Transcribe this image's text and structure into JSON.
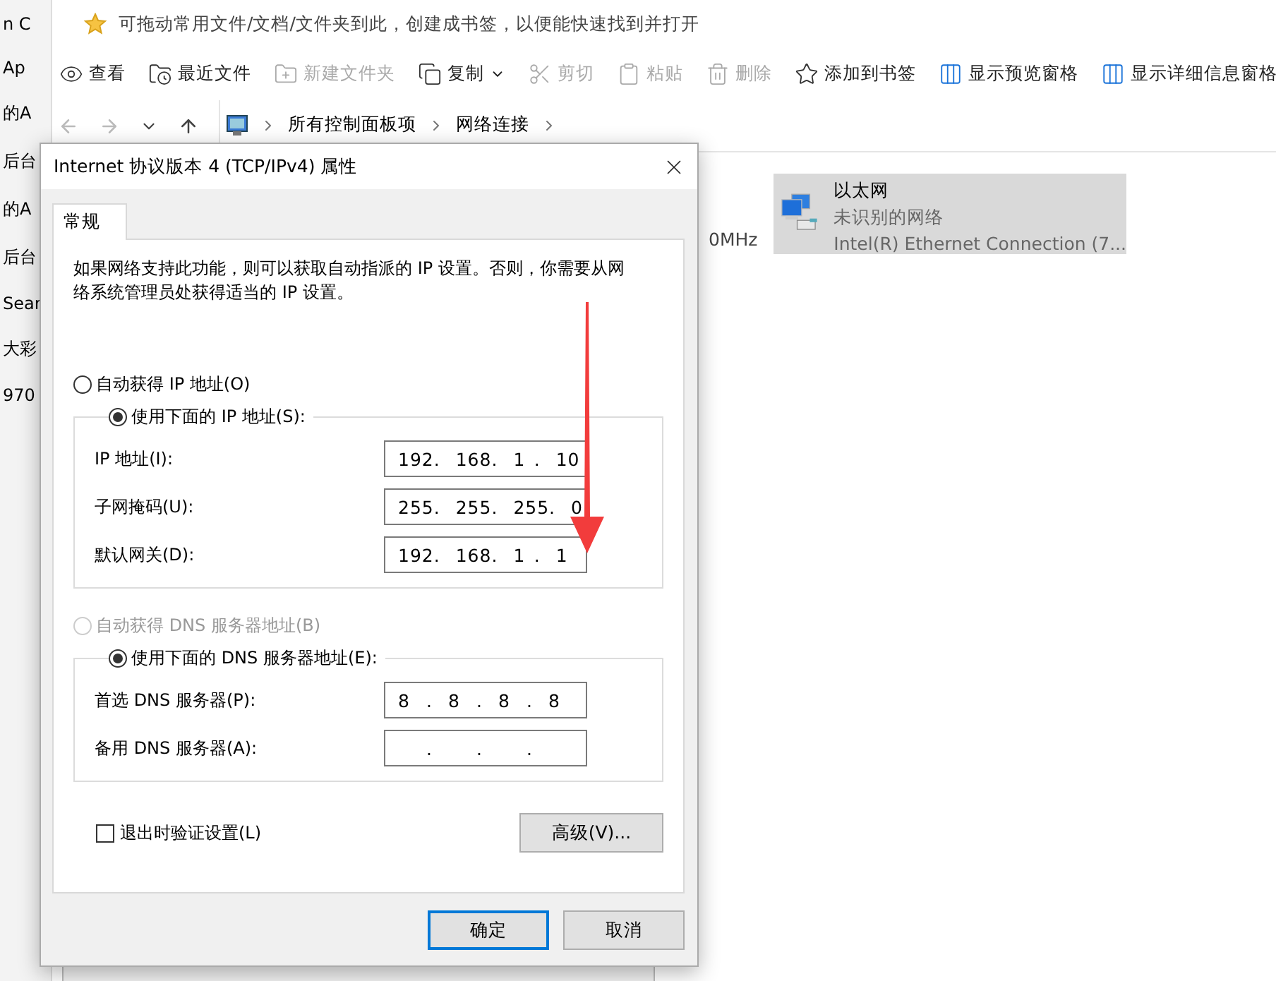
{
  "left_strip": [
    "n C",
    "Ap",
    "的A",
    "后台",
    "的A",
    "后台",
    "Sear",
    "大彩",
    "970"
  ],
  "bookmark_bar": {
    "hint": "可拖动常用文件/文档/文件夹到此，创建成书签，以便能快速找到并打开"
  },
  "toolbar": [
    {
      "kind": "view",
      "label": "查看",
      "disabled": false
    },
    {
      "kind": "recent",
      "label": "最近文件",
      "disabled": false
    },
    {
      "kind": "newfolder",
      "label": "新建文件夹",
      "disabled": true
    },
    {
      "kind": "copy",
      "label": "复制",
      "disabled": false,
      "menu": true
    },
    {
      "kind": "cut",
      "label": "剪切",
      "disabled": true
    },
    {
      "kind": "paste",
      "label": "粘贴",
      "disabled": true
    },
    {
      "kind": "delete",
      "label": "删除",
      "disabled": true
    },
    {
      "kind": "bookmark",
      "label": "添加到书签",
      "disabled": false
    },
    {
      "kind": "pane",
      "label": "显示预览窗格",
      "disabled": false
    },
    {
      "kind": "pane",
      "label": "显示详细信息窗格",
      "disabled": false
    }
  ],
  "address_bar": {
    "crumbs": [
      "所有控制面板项",
      "网络连接"
    ]
  },
  "content": {
    "partial_text": "0MHz",
    "adapter": {
      "name": "以太网",
      "status": "未识别的网络",
      "device": "Intel(R) Ethernet Connection (7...",
      "selected": true
    }
  },
  "dialog": {
    "title": "Internet 协议版本 4 (TCP/IPv4) 属性",
    "tabs": [
      {
        "label": "常规",
        "selected": true
      }
    ],
    "description": "如果网络支持此功能，则可以获取自动指派的 IP 设置。否则，你需要从网络系统管理员处获得适当的 IP 设置。",
    "separator": ".",
    "ip_mode": [
      {
        "label": "自动获得 IP 地址(O)",
        "selected": false,
        "disabled": false
      },
      {
        "label": "使用下面的 IP 地址(S):",
        "selected": true,
        "disabled": false
      }
    ],
    "ip_fields": [
      {
        "label": "IP 地址(I):",
        "octets": [
          "192",
          "168",
          "1",
          "10"
        ]
      },
      {
        "label": "子网掩码(U):",
        "octets": [
          "255",
          "255",
          "255",
          "0"
        ]
      },
      {
        "label": "默认网关(D):",
        "octets": [
          "192",
          "168",
          "1",
          "1"
        ]
      }
    ],
    "dns_mode": [
      {
        "label": "自动获得 DNS 服务器地址(B)",
        "selected": false,
        "disabled": true
      },
      {
        "label": "使用下面的 DNS 服务器地址(E):",
        "selected": true,
        "disabled": false
      }
    ],
    "dns_fields": [
      {
        "label": "首选 DNS 服务器(P):",
        "octets": [
          "8",
          "8",
          "8",
          "8"
        ]
      },
      {
        "label": "备用 DNS 服务器(A):"
      }
    ],
    "validate": {
      "label": "退出时验证设置(L)",
      "checked": false
    },
    "advanced": {
      "label": "高级(V)...",
      "default": false
    },
    "buttons": [
      {
        "label": "确定",
        "default": true
      },
      {
        "label": "取消",
        "default": false
      }
    ]
  }
}
